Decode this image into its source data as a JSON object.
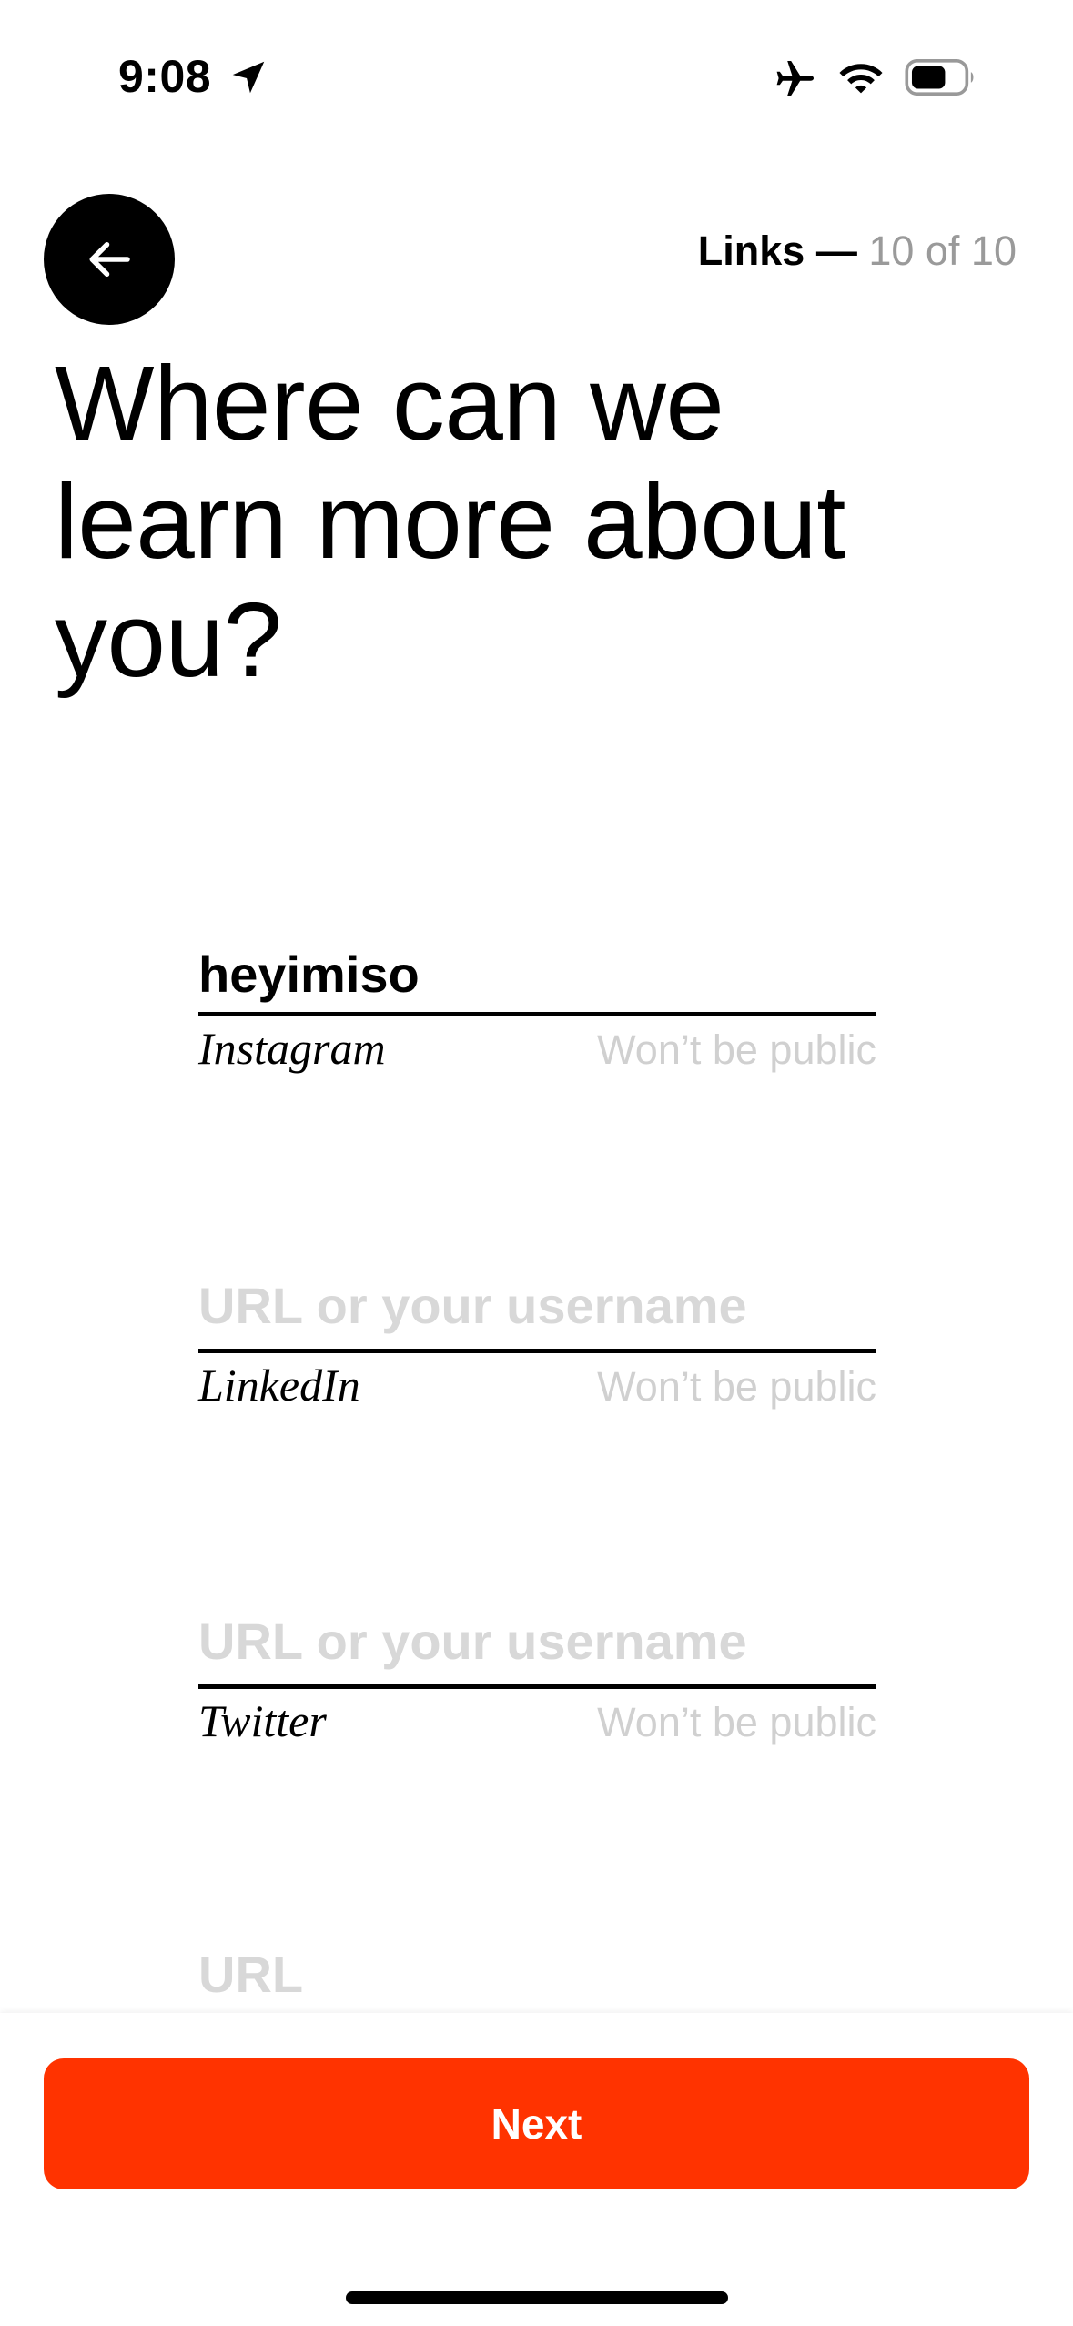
{
  "status_bar": {
    "time": "9:08",
    "icons": [
      "location-arrow-icon",
      "airplane-icon",
      "wifi-icon",
      "battery-icon"
    ]
  },
  "header": {
    "back_icon": "arrow-left-icon",
    "step_label": "Links",
    "step_dash": "—",
    "step_count": "10 of 10"
  },
  "title_lines": [
    "Where can we",
    "learn more about",
    "you?"
  ],
  "fields": [
    {
      "value": "heyimiso",
      "placeholder": "",
      "name": "Instagram",
      "note": "Won’t be public"
    },
    {
      "value": "",
      "placeholder": "URL or your username",
      "name": "LinkedIn",
      "note": "Won’t be public"
    },
    {
      "value": "",
      "placeholder": "URL or your username",
      "name": "Twitter",
      "note": "Won’t be public"
    },
    {
      "value": "",
      "placeholder": "URL"
    }
  ],
  "footer": {
    "next_label": "Next"
  },
  "colors": {
    "accent": "#ff3300",
    "muted": "#9a9a9a",
    "placeholder": "#d8d8d8"
  }
}
